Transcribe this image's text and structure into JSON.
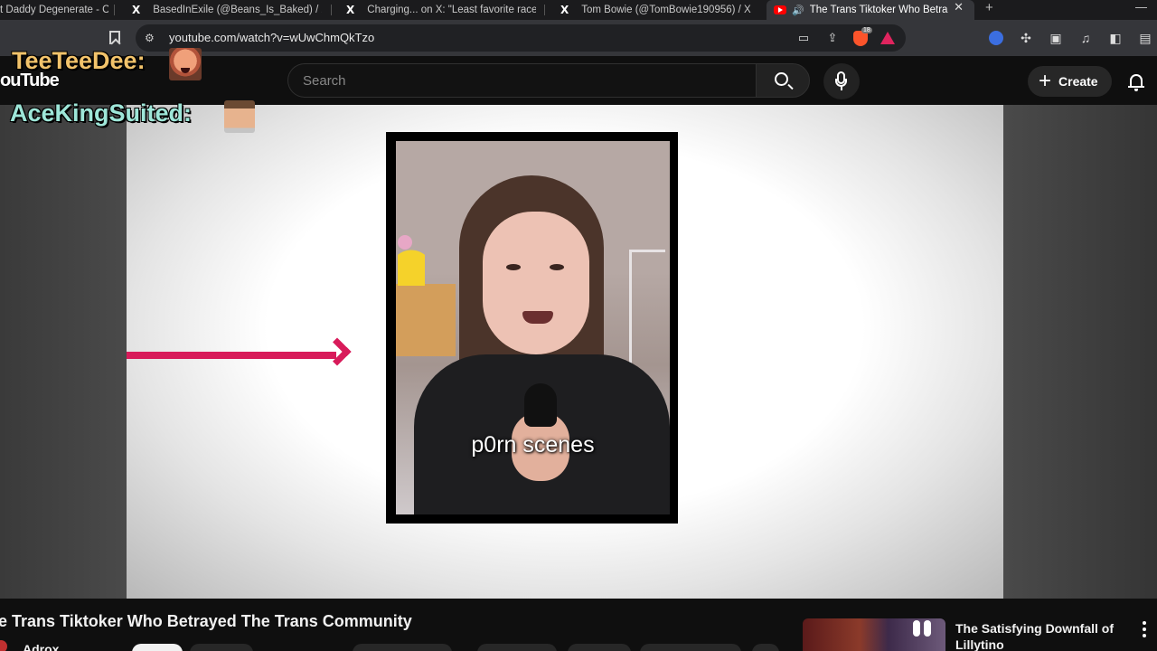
{
  "browser": {
    "tabs": [
      {
        "title": "t Daddy Degenerate - C"
      },
      {
        "title": "BasedInExile (@Beans_Is_Baked) / X"
      },
      {
        "title": "Charging... on X: \"Least favorite race"
      },
      {
        "title": "Tom Bowie (@TomBowie190956) / X"
      },
      {
        "title": "The Trans Tiktoker Who Betra"
      }
    ],
    "x_logo": "X",
    "new_tab": "+",
    "close_tab": "✕",
    "minimize": "—",
    "url": "youtube.com/watch?v=wUwChmQkTzo",
    "brave_badge": "18"
  },
  "youtube": {
    "logo": "ouTube",
    "search_placeholder": "Search",
    "create_label": "Create",
    "create_plus": "+"
  },
  "overlay": {
    "user1": "TeeTeeDee:",
    "user2": "AceKingSuited:"
  },
  "video": {
    "caption": "p0rn scenes",
    "title": "e Trans Tiktoker Who Betrayed The Trans Community",
    "channel": "Adrox"
  },
  "recommendation": {
    "title": "The Satisfying Downfall of Lillytino"
  },
  "colors": {
    "youtube_red": "#ff0000",
    "arrow_pink": "#d81b5a"
  }
}
